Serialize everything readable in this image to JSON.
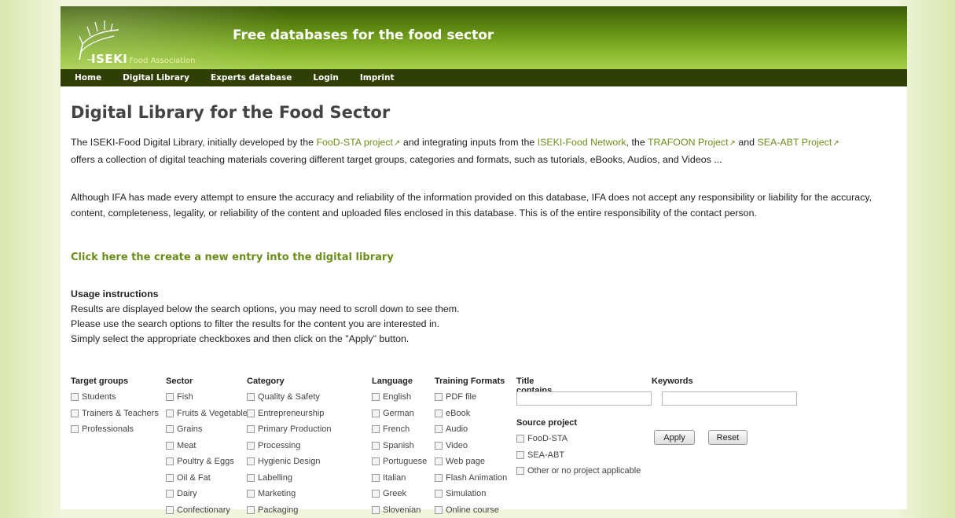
{
  "header": {
    "logo_iseki": "ISEKI",
    "logo_assoc": "Food Association",
    "title": "Free databases for the food sector"
  },
  "nav": [
    "Home",
    "Digital Library",
    "Experts database",
    "Login",
    "Imprint"
  ],
  "page_title": "Digital Library for the Food Sector",
  "intro": {
    "t1": "The ISEKI-Food Digital Library, initially developed by the ",
    "link_foodsta": "FooD-STA project",
    "t2": " and integrating inputs from the ",
    "link_network": "ISEKI-Food Network",
    "t3": ", the ",
    "link_trafoon": "TRAFOON Project",
    "t4": " and ",
    "link_seaabt": "SEA-ABT Project",
    "t5": "offers a collection of digital teaching materials covering different target groups, categories and formats, such as tutorials, eBooks, Audios, and Videos ..."
  },
  "disclaimer": "Although IFA has made every attempt to ensure the accuracy and reliability of the information provided on this database, IFA does not accept any responsibility or liability for the accuracy, content, completeness, legality, or reliability of the content and uploaded files enclosed in this database. This is of the entire responsibility of the contact person.",
  "create_link": "Click here the create a new entry into the digital library",
  "usage": {
    "heading": "Usage instructions",
    "lines": [
      "Results are displayed below the search options, you may need to scroll down to see them.",
      "Please use the search options to filter the results for the content you are interested in.",
      "Simply select the appropriate checkboxes and then click on the \"Apply\" button."
    ]
  },
  "filters": {
    "target_groups": {
      "heading": "Target groups",
      "options": [
        "Students",
        "Trainers & Teachers",
        "Professionals"
      ]
    },
    "sector": {
      "heading": "Sector",
      "options": [
        "Fish",
        "Fruits & Vegetables",
        "Grains",
        "Meat",
        "Poultry & Eggs",
        "Oil & Fat",
        "Dairy",
        "Confectionary"
      ]
    },
    "category": {
      "heading": "Category",
      "options": [
        "Quality & Safety",
        "Entrepreneurship",
        "Primary Production",
        "Processing",
        "Hygienic Design",
        "Labelling",
        "Marketing",
        "Packaging"
      ]
    },
    "language": {
      "heading": "Language",
      "options": [
        "English",
        "German",
        "French",
        "Spanish",
        "Portuguese",
        "Italian",
        "Greek",
        "Slovenian"
      ]
    },
    "formats": {
      "heading": "Training Formats",
      "options": [
        "PDF file",
        "eBook",
        "Audio",
        "Video",
        "Web page",
        "Flash Animation",
        "Simulation",
        "Online course"
      ]
    },
    "title_contains": {
      "heading": "Title contains ...",
      "value": ""
    },
    "keywords": {
      "heading": "Keywords",
      "value": ""
    },
    "source_project": {
      "heading": "Source project",
      "options": [
        "FooD-STA",
        "SEA-ABT",
        "Other or no project applicable"
      ]
    },
    "apply_label": "Apply",
    "reset_label": "Reset"
  },
  "icons": {
    "external_link": "external-link-icon",
    "logo": "iseki-logo-icon"
  },
  "colors": {
    "link": "#6b8e1a",
    "nav_bg": "#2f3f06",
    "header_top": "#3b5a06",
    "header_bottom": "#a7cf4c"
  }
}
